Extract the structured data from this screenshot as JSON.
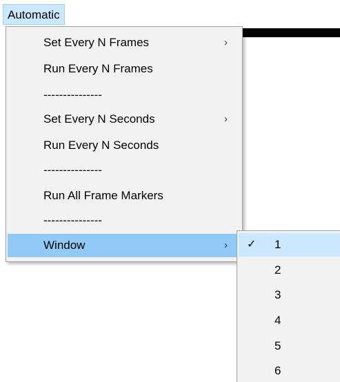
{
  "menubar": {
    "title": "Automatic"
  },
  "menu": {
    "items": [
      {
        "label": "Set Every N Frames",
        "arrow": "›"
      },
      {
        "label": "Run Every N Frames"
      },
      {
        "label": "---------------"
      },
      {
        "label": "Set Every N Seconds",
        "arrow": "›"
      },
      {
        "label": "Run Every N Seconds"
      },
      {
        "label": "---------------"
      },
      {
        "label": "Run All Frame Markers"
      },
      {
        "label": "---------------"
      },
      {
        "label": "Window",
        "arrow": "›"
      }
    ]
  },
  "submenu": {
    "check": "✓",
    "items": [
      "1",
      "2",
      "3",
      "4",
      "5",
      "6"
    ]
  },
  "colors": {
    "highlight": "#91c9f7",
    "menubar_selected": "#cce8ff",
    "menu_background": "#f2f2f2"
  }
}
